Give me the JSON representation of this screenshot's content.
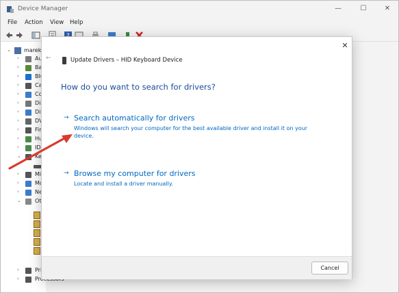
{
  "window": {
    "title": "Device Manager",
    "minimize": "—",
    "maximize": "☐",
    "close": "✕"
  },
  "menu": {
    "items": [
      "File",
      "Action",
      "View",
      "Help"
    ]
  },
  "tree": {
    "root_label": "marek",
    "items": [
      {
        "label": "Au",
        "icon": "audio-icon",
        "color": "#7a7a7a"
      },
      {
        "label": "Ba",
        "icon": "battery-icon",
        "color": "#5a8a3a"
      },
      {
        "label": "Blu",
        "icon": "bluetooth-icon",
        "color": "#1e6fd0"
      },
      {
        "label": "Ca",
        "icon": "camera-icon",
        "color": "#555555"
      },
      {
        "label": "Co",
        "icon": "computer-icon",
        "color": "#3d7cc9"
      },
      {
        "label": "Dis",
        "icon": "disk-icon",
        "color": "#777777"
      },
      {
        "label": "Dis",
        "icon": "display-icon",
        "color": "#3d7cc9"
      },
      {
        "label": "DV",
        "icon": "dvd-icon",
        "color": "#666666"
      },
      {
        "label": "Fir",
        "icon": "firmware-icon",
        "color": "#555555"
      },
      {
        "label": "Hu",
        "icon": "hid-icon",
        "color": "#4b8c4b"
      },
      {
        "label": "IDI",
        "icon": "ide-icon",
        "color": "#4b8c4b"
      },
      {
        "label": "Ke",
        "icon": "keyboard-icon",
        "color": "#555555"
      },
      {
        "label": "",
        "icon": "keyboard-device-icon",
        "color": "#555555"
      },
      {
        "label": "Mi",
        "icon": "mice-icon",
        "color": "#555555"
      },
      {
        "label": "Mo",
        "icon": "monitor-icon",
        "color": "#3d7cc9"
      },
      {
        "label": "Ne",
        "icon": "network-icon",
        "color": "#3d7cc9"
      },
      {
        "label": "Ot",
        "icon": "other-devices-icon",
        "color": "#888888"
      }
    ],
    "bottom_items": [
      {
        "label": "Pri",
        "icon": "printer-icon",
        "color": "#555555"
      },
      {
        "label": "Processors",
        "icon": "processor-icon",
        "color": "#555555"
      }
    ]
  },
  "dialog": {
    "close": "✕",
    "back": "←",
    "header_title": "Update Drivers – HID Keyboard Device",
    "question": "How do you want to search for drivers?",
    "options": [
      {
        "title": "Search automatically for drivers",
        "description": "Windows will search your computer for the best available driver and install it on your device."
      },
      {
        "title": "Browse my computer for drivers",
        "description": "Locate and install a driver manually."
      }
    ],
    "arrow_glyph": "→",
    "cancel_label": "Cancel"
  },
  "annotation": {
    "color": "#d93a2b"
  }
}
